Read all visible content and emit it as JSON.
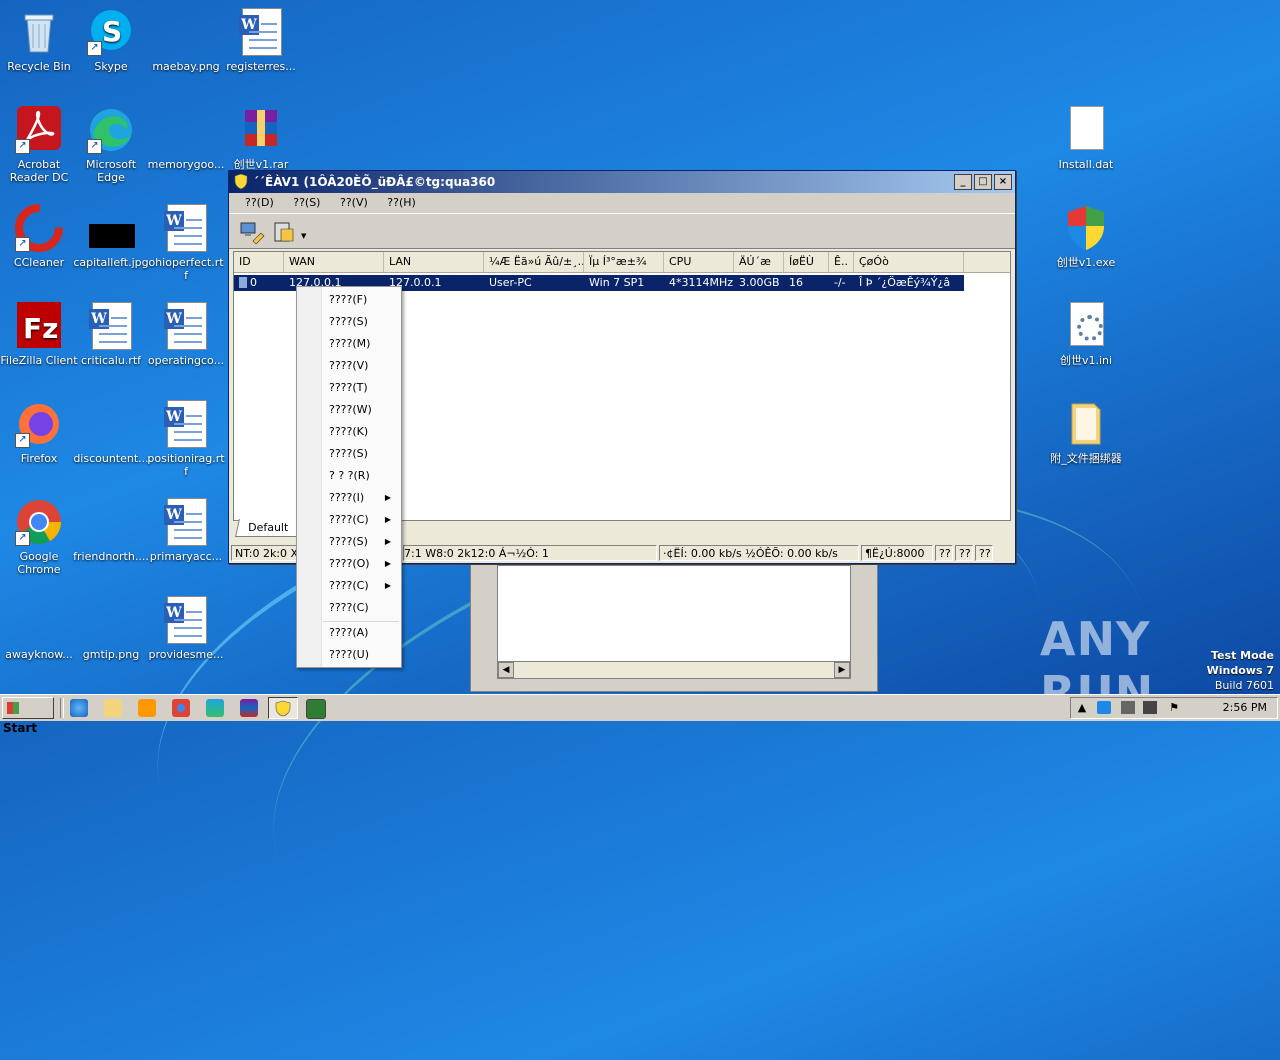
{
  "desktop": {
    "icons": [
      {
        "label": "Recycle Bin",
        "icon": "recycle-bin-icon"
      },
      {
        "label": "Skype",
        "icon": "skype-icon"
      },
      {
        "label": "maebay.png",
        "icon": "image-file-icon"
      },
      {
        "label": "registerres...",
        "icon": "word-doc-icon"
      },
      {
        "label": "Acrobat Reader DC",
        "icon": "acrobat-icon"
      },
      {
        "label": "Microsoft Edge",
        "icon": "edge-icon"
      },
      {
        "label": "memorygoo...",
        "icon": "image-file-icon"
      },
      {
        "label": "创世v1.rar",
        "icon": "winrar-icon"
      },
      {
        "label": "CCleaner",
        "icon": "ccleaner-icon"
      },
      {
        "label": "capitalleft.jpg",
        "icon": "image-file-icon"
      },
      {
        "label": "ohioperfect.rtf",
        "icon": "word-doc-icon"
      },
      {
        "label": "FileZilla Client",
        "icon": "filezilla-icon"
      },
      {
        "label": "criticalu.rtf",
        "icon": "word-doc-icon"
      },
      {
        "label": "operatingco...",
        "icon": "word-doc-icon"
      },
      {
        "label": "Firefox",
        "icon": "firefox-icon"
      },
      {
        "label": "discountent...",
        "icon": "image-file-icon"
      },
      {
        "label": "positionirag.rtf",
        "icon": "word-doc-icon"
      },
      {
        "label": "Google Chrome",
        "icon": "chrome-icon"
      },
      {
        "label": "friendnorth....",
        "icon": "image-file-icon"
      },
      {
        "label": "primaryacc...",
        "icon": "word-doc-icon"
      },
      {
        "label": "awayknow...",
        "icon": "image-file-icon"
      },
      {
        "label": "gmtip.png",
        "icon": "image-file-icon"
      },
      {
        "label": "providesme...",
        "icon": "word-doc-icon"
      },
      {
        "label": "Install.dat",
        "icon": "file-icon"
      },
      {
        "label": "创世v1.exe",
        "icon": "shield-icon"
      },
      {
        "label": "创世v1.ini",
        "icon": "settings-file-icon"
      },
      {
        "label": "附_文件捆绑器",
        "icon": "folder-icon"
      }
    ]
  },
  "window": {
    "title": "´´ÊÀV1 (1ÔÂ20ÈÕ_üÐÂ£©tg:qua360",
    "menu": [
      "??(D)",
      "??(S)",
      "??(V)",
      "??(H)"
    ],
    "columns": [
      "ID",
      "WAN",
      "LAN",
      "¼Æ Ëã»ú Ãû/±¸..",
      "Ïµ Í³°æ±¾",
      "CPU",
      "ÄÚ´æ",
      "ÍøËÙ",
      "Ê..",
      "ÇøÓò"
    ],
    "row": [
      "0",
      "127.0.0.1",
      "127.0.0.1",
      "User-PC",
      "Win 7 SP1",
      "4*3114MHz",
      "3.00GB",
      "16",
      "-/-",
      "Î Þ ´¿ÖæÊý¾Ý¿â"
    ],
    "tab": "Default",
    "status": {
      "left": "NT:0 2k:0 XP",
      "middle": "7:1 W8:0 2k12:0 Á¬½Ó: 1",
      "speed": "·¢ËÍ: 0.00 kb/s ½ÓÊÕ: 0.00 kb/s",
      "port": "¶Ë¿Ú:8000",
      "q1": "??",
      "q2": "??",
      "q3": "??"
    }
  },
  "context_menu": {
    "items": [
      {
        "label": "????(F)",
        "submenu": false
      },
      {
        "label": "????(S)",
        "submenu": false
      },
      {
        "label": "????(M)",
        "submenu": false
      },
      {
        "label": "????(V)",
        "submenu": false
      },
      {
        "label": "????(T)",
        "submenu": false
      },
      {
        "label": "????(W)",
        "submenu": false
      },
      {
        "label": "????(K)",
        "submenu": false
      },
      {
        "label": "????(S)",
        "submenu": false
      },
      {
        "label": "? ? ?(R)",
        "submenu": false
      },
      {
        "label": "????(I)",
        "submenu": true
      },
      {
        "label": "????(C)",
        "submenu": true
      },
      {
        "label": "????(S)",
        "submenu": true
      },
      {
        "label": "????(O)",
        "submenu": true
      },
      {
        "label": "????(C)",
        "submenu": true
      },
      {
        "label": "????(C)",
        "submenu": false
      },
      {
        "label": "????(A)",
        "submenu": false
      },
      {
        "label": "????(U)",
        "submenu": false
      }
    ]
  },
  "taskbar": {
    "start": "Start",
    "clock": "2:56 PM"
  },
  "watermark": "ANY RUN",
  "testmode": {
    "line1": "Test Mode",
    "line2": "Windows 7",
    "line3": "Build 7601"
  }
}
